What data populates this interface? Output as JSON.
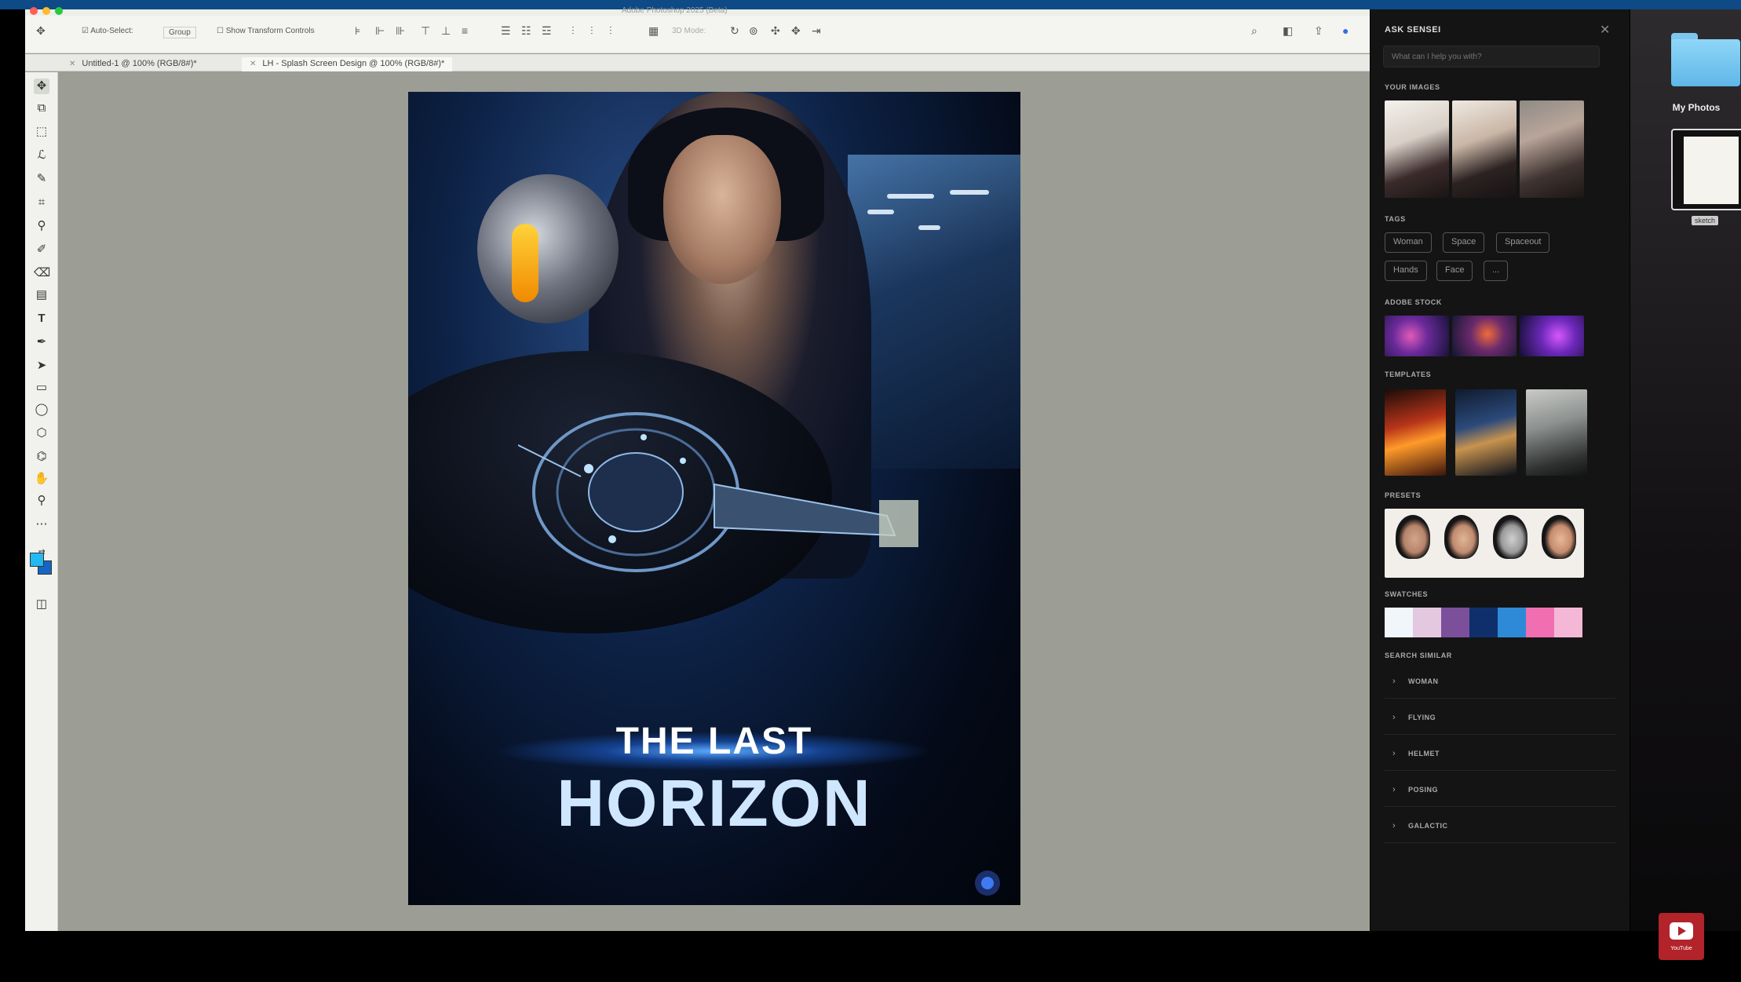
{
  "window": {
    "title": "Adobe Photoshop 2025 (Beta)"
  },
  "options_bar": {
    "auto_select_label": "Auto-Select:",
    "auto_select_value": "Group",
    "show_transform_label": "Show Transform Controls",
    "mode_label": "3D Mode:"
  },
  "documents": [
    {
      "label": "Untitled-1 @ 100% (RGB/8#)*"
    },
    {
      "label": "LH - Splash Screen Design @ 100% (RGB/8#)*"
    }
  ],
  "tools": [
    "move",
    "artboard",
    "marquee",
    "lasso",
    "quick-select",
    "crop",
    "eyedropper",
    "brush",
    "eraser",
    "gradient",
    "type",
    "pen",
    "path-select",
    "rectangle",
    "ellipse",
    "polygon",
    "custom-shape",
    "hand",
    "zoom",
    "more",
    "swap-colors",
    "quick-mask"
  ],
  "poster": {
    "line1": "THE LAST",
    "line2": "HORIZON"
  },
  "sensei": {
    "title": "ASK SENSEI",
    "placeholder": "What can I help you with?",
    "sections": {
      "images": "YOUR IMAGES",
      "tags": "TAGS",
      "stock": "ADOBE STOCK",
      "templates": "TEMPLATES",
      "presets": "PRESETS",
      "swatches": "SWATCHES",
      "similar": "SEARCH SIMILAR"
    },
    "tags": [
      "Woman",
      "Space",
      "Spaceout",
      "Hands",
      "Face",
      "..."
    ],
    "swatch_colors": [
      "#f1f6fb",
      "#e3c8e0",
      "#7b4f9a",
      "#0e2f6b",
      "#2e8ad7",
      "#f06fb0",
      "#f4b8d6"
    ],
    "similar": [
      "WOMAN",
      "FLYING",
      "HELMET",
      "POSING",
      "GALACTIC"
    ]
  },
  "desktop": {
    "folder_label": "My Photos",
    "file_label": "sketch"
  },
  "youtube": {
    "label": "YouTube"
  }
}
